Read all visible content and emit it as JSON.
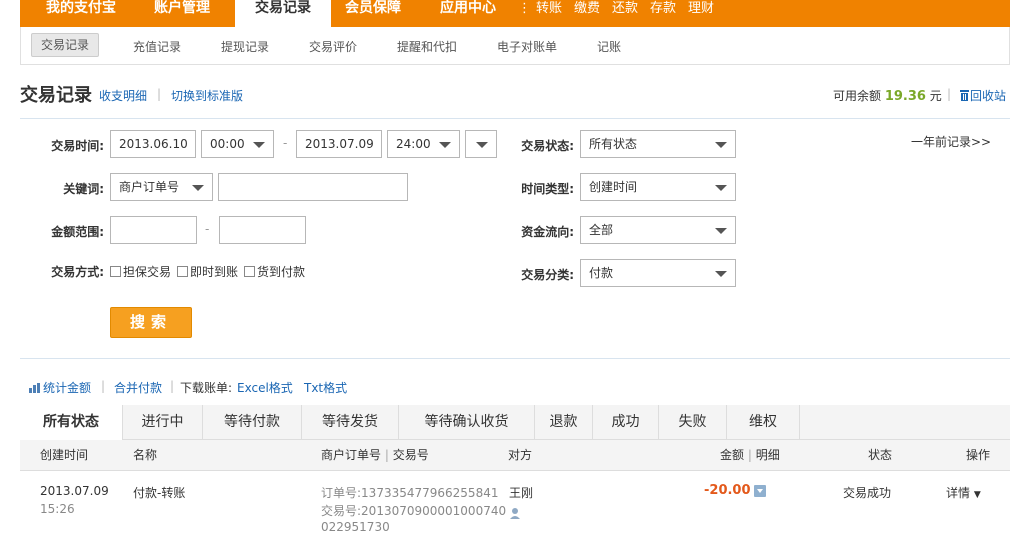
{
  "topnav": {
    "tabs": [
      "我的支付宝",
      "账户管理",
      "交易记录",
      "会员保障",
      "应用中心"
    ],
    "quick_links": [
      "转账",
      "缴费",
      "还款",
      "存款",
      "理财"
    ],
    "active": "交易记录"
  },
  "subnav": {
    "items": [
      "交易记录",
      "充值记录",
      "提现记录",
      "交易评价",
      "提醒和代扣",
      "电子对账单",
      "记账"
    ],
    "active": "交易记录"
  },
  "header": {
    "title": "交易记录",
    "link1": "收支明细",
    "link2": "切换到标准版",
    "balance_label": "可用余额",
    "balance_value": "19.36",
    "balance_unit": "元",
    "recycle": "回收站"
  },
  "filters": {
    "time_label": "交易时间:",
    "start_date": "2013.06.10",
    "start_time": "00:00",
    "end_date": "2013.07.09",
    "end_time": "24:00",
    "keyword_label": "关键词:",
    "keyword_type": "商户订单号",
    "keyword_value": "",
    "amount_label": "金额范围:",
    "amount_min": "",
    "amount_max": "",
    "method_label": "交易方式:",
    "methods": [
      "担保交易",
      "即时到账",
      "货到付款"
    ],
    "status_label": "交易状态:",
    "status_value": "所有状态",
    "timetype_label": "时间类型:",
    "timetype_value": "创建时间",
    "flow_label": "资金流向:",
    "flow_value": "全部",
    "category_label": "交易分类:",
    "category_value": "付款",
    "older_link": "一年前记录>>",
    "search_button": "搜索"
  },
  "tools": {
    "stats": "统计金额",
    "merge": "合并付款",
    "download_label": "下载账单:",
    "excel": "Excel格式",
    "txt": "Txt格式"
  },
  "status_tabs": [
    "所有状态",
    "进行中",
    "等待付款",
    "等待发货",
    "等待确认收货",
    "退款",
    "成功",
    "失败",
    "维权"
  ],
  "table": {
    "headers": {
      "created": "创建时间",
      "name": "名称",
      "order_no": "商户订单号",
      "trade_no": "交易号",
      "party": "对方",
      "amount": "金额",
      "detail": "明细",
      "status": "状态",
      "action": "操作"
    },
    "rows": [
      {
        "date": "2013.07.09",
        "time": "15:26",
        "name": "付款-转账",
        "order_line": "订单号:137335477966255841",
        "trade_line1": "交易号:2013070900001000740",
        "trade_line2": "022951730",
        "party": "王刚",
        "amount": "-20.00",
        "status": "交易成功",
        "action": "详情"
      }
    ]
  },
  "colors": {
    "brand_orange": "#f08200",
    "link_blue": "#1a66b3",
    "balance_green": "#7ba829",
    "negative_amount": "#e3591b"
  }
}
